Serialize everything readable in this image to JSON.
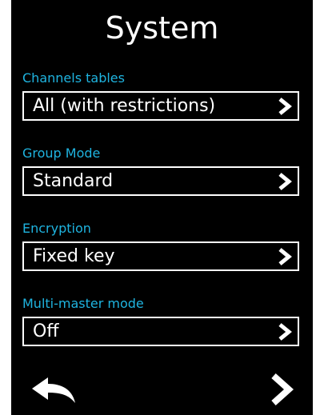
{
  "screen": {
    "title": "System",
    "background_color": "#000000",
    "label_color": "#1fb4e0",
    "text_color": "#ffffff"
  },
  "settings": [
    {
      "label": "Channels tables",
      "value": "All (with restrictions)",
      "icon": "chevron-right-icon"
    },
    {
      "label": "Group Mode",
      "value": "Standard",
      "icon": "chevron-right-icon"
    },
    {
      "label": "Encryption",
      "value": "Fixed key",
      "icon": "chevron-right-icon"
    },
    {
      "label": "Multi-master mode",
      "value": "Off",
      "icon": "chevron-right-icon"
    }
  ],
  "navigation": {
    "back_icon": "back-arrow-icon",
    "next_icon": "chevron-right-icon"
  }
}
